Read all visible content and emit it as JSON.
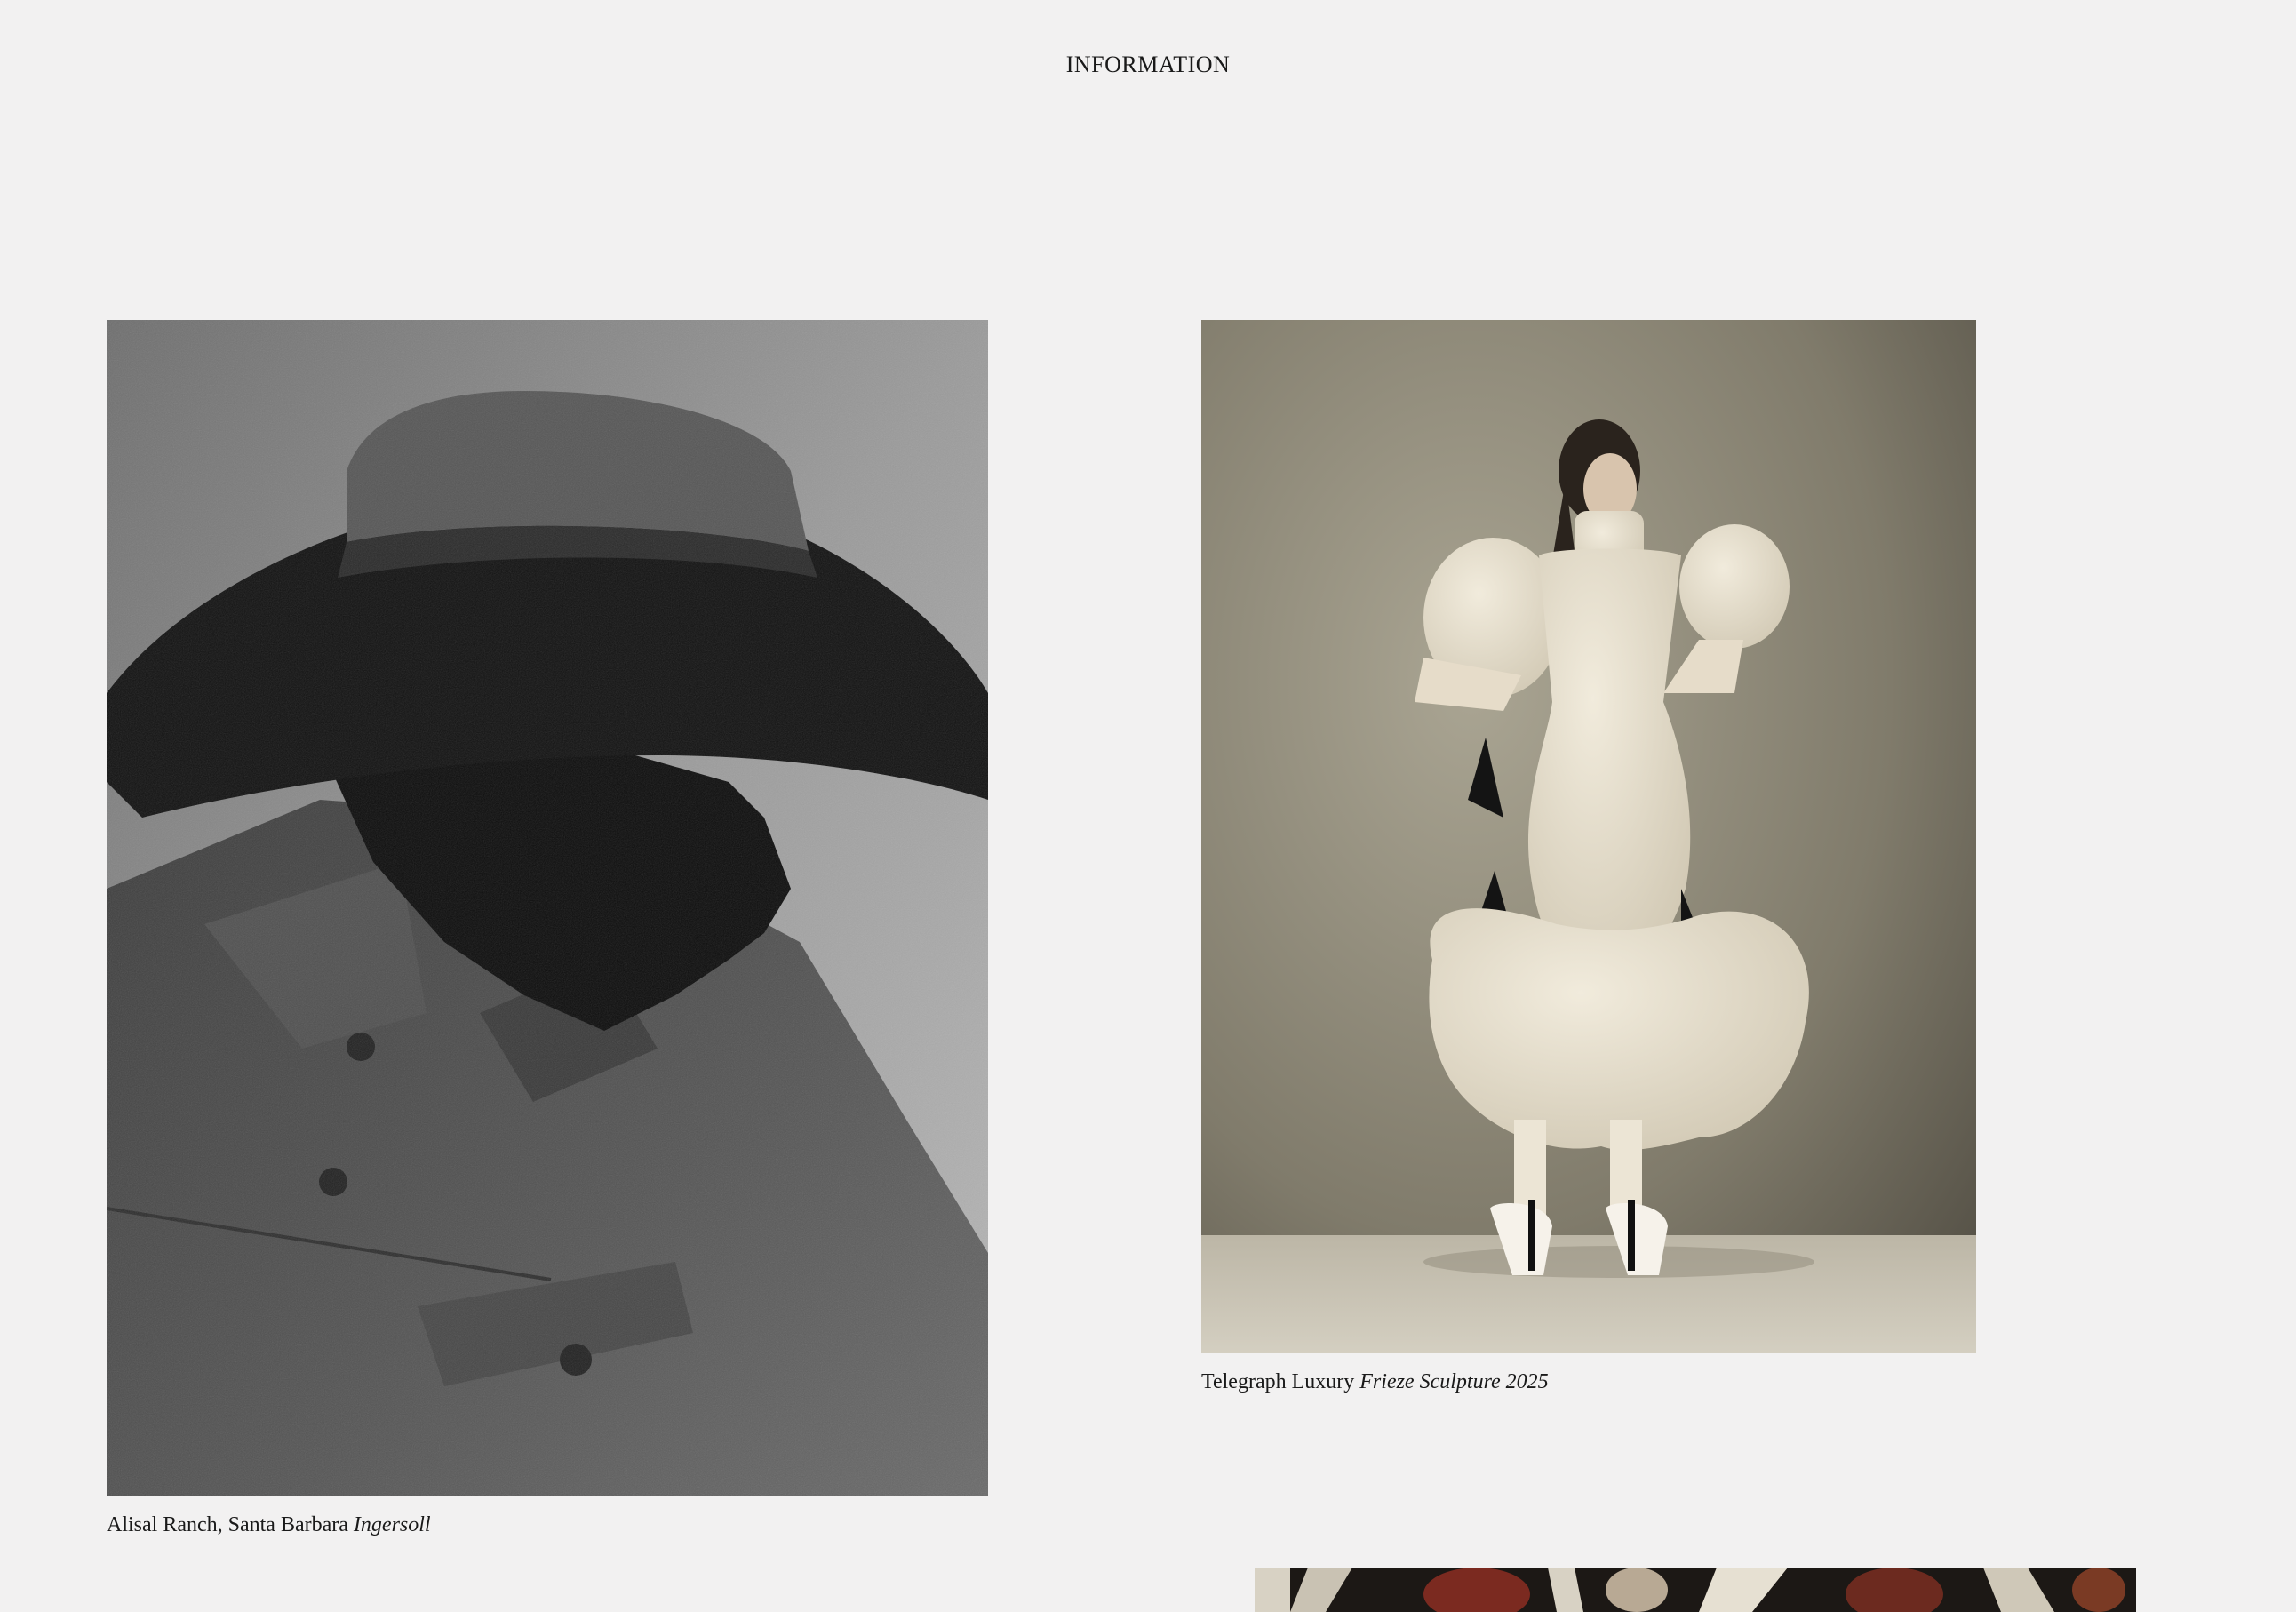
{
  "nav": {
    "information_label": "INFORMATION"
  },
  "projects": [
    {
      "location": "Alisal Ranch, Santa Barbara",
      "title": "Ingersoll",
      "image_icon": "cowboy-portrait-photo"
    },
    {
      "location": "Telegraph Luxury",
      "title": "Frieze Sculpture 2025",
      "image_icon": "sculptural-dress-photo"
    },
    {
      "image_icon": "partial-photo"
    }
  ],
  "colors": {
    "background": "#f2f1f1",
    "text": "#1a1a1a"
  }
}
